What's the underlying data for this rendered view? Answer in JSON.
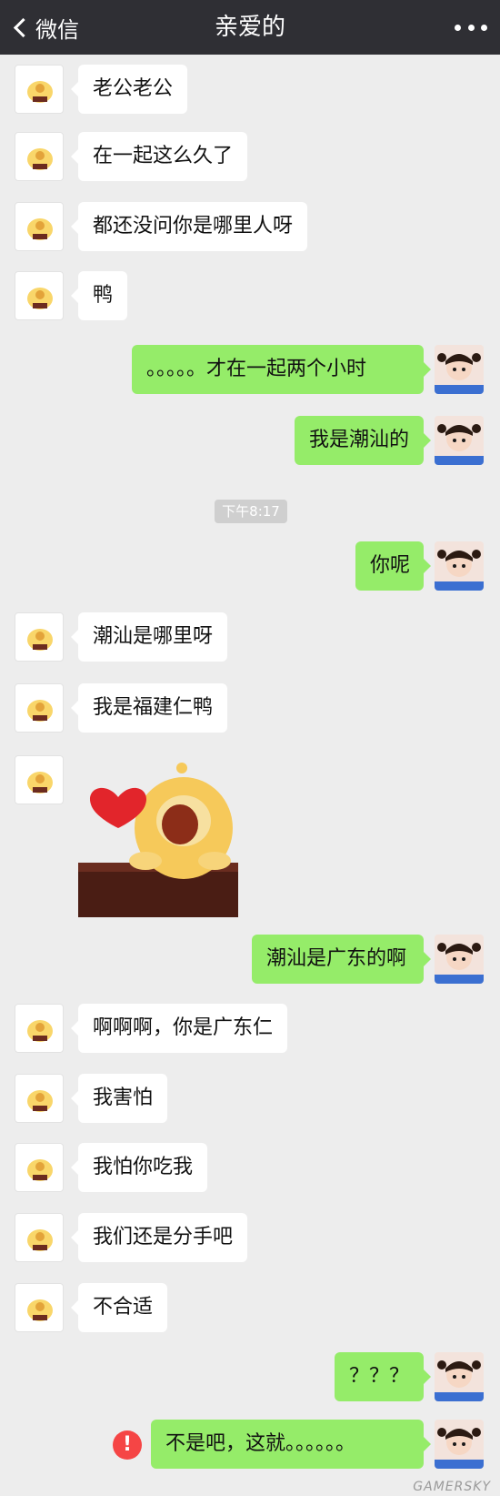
{
  "header": {
    "back_label": "微信",
    "title": "亲爱的"
  },
  "messages": [
    {
      "side": "left",
      "text": "老公老公"
    },
    {
      "side": "left",
      "text": "在一起这么久了"
    },
    {
      "side": "left",
      "text": "都还没问你是哪里人呀"
    },
    {
      "side": "left",
      "text": "鸭"
    },
    {
      "side": "right",
      "text": "。。。。。才在一起两个小时"
    },
    {
      "side": "right",
      "text": "我是潮汕的"
    },
    {
      "side": "right",
      "text": "你呢"
    },
    {
      "side": "left",
      "text": "潮汕是哪里呀"
    },
    {
      "side": "left",
      "text": "我是福建仁鸭"
    },
    {
      "side": "right",
      "text": "潮汕是广东的啊"
    },
    {
      "side": "left",
      "text": "啊啊啊，你是广东仁"
    },
    {
      "side": "left",
      "text": "我害怕"
    },
    {
      "side": "left",
      "text": "我怕你吃我"
    },
    {
      "side": "left",
      "text": "我们还是分手吧"
    },
    {
      "side": "left",
      "text": "不合适"
    },
    {
      "side": "right",
      "text": "？？？"
    },
    {
      "side": "right",
      "text": "不是吧，这就。。。。。。"
    }
  ],
  "timestamp": "下午8:17",
  "error_icon_glyph": "!",
  "watermark": "GAMERSKY",
  "colors": {
    "header_bg": "#2f2f34",
    "chat_bg": "#ededed",
    "bubble_sent": "#95ec69",
    "bubble_received": "#ffffff",
    "error": "#f54545"
  },
  "icons": {
    "back": "chevron-left-icon",
    "more": "more-dots-icon",
    "error": "exclamation-circle-icon"
  }
}
